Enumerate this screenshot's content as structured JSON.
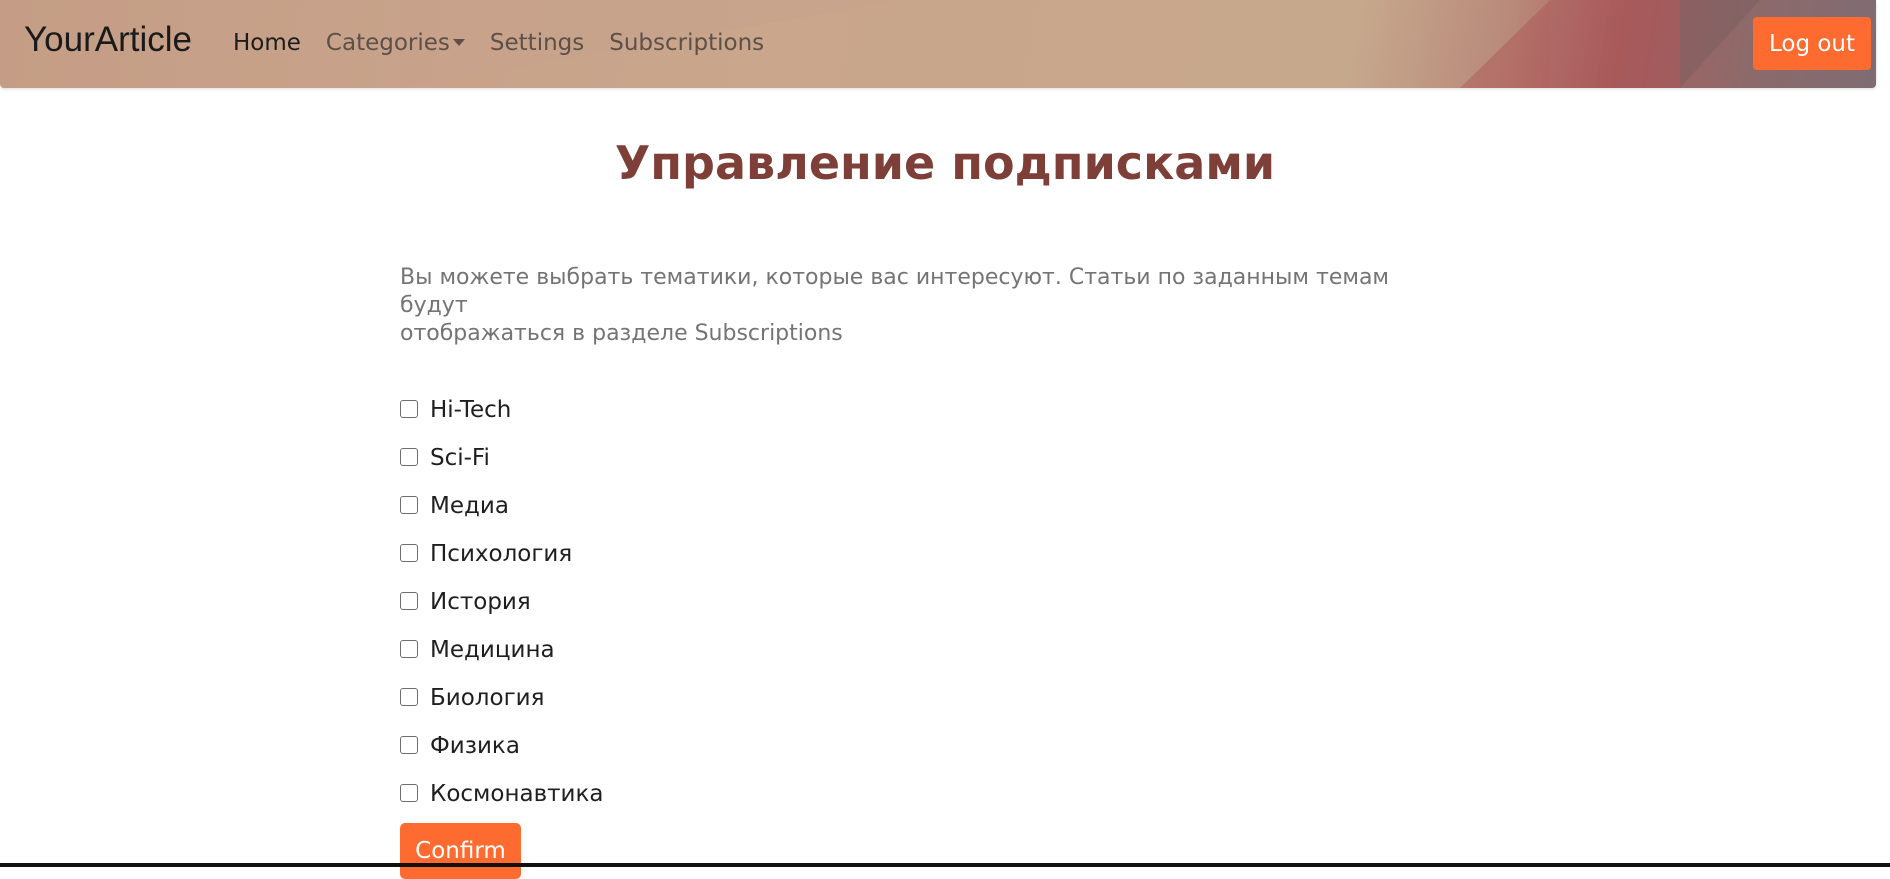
{
  "navbar": {
    "brand": "YourArticle",
    "links": [
      {
        "label": "Home"
      },
      {
        "label": "Categories"
      },
      {
        "label": "Settings"
      },
      {
        "label": "Subscriptions"
      }
    ],
    "logout_label": "Log out"
  },
  "main": {
    "title": "Управление подписками",
    "description_line1": "Вы можете выбрать тематики, которые вас интересуют. Статьи по заданным темам будут",
    "description_line2": "отображаться в разделе Subscriptions",
    "topics": [
      {
        "label": "Hi-Tech",
        "checked": false
      },
      {
        "label": "Sci-Fi",
        "checked": false
      },
      {
        "label": "Медиа",
        "checked": false
      },
      {
        "label": "Психология",
        "checked": false
      },
      {
        "label": "История",
        "checked": false
      },
      {
        "label": "Медицина",
        "checked": false
      },
      {
        "label": "Биология",
        "checked": false
      },
      {
        "label": "Физика",
        "checked": false
      },
      {
        "label": "Космонавтика",
        "checked": false
      }
    ],
    "confirm_label": "Confirm"
  },
  "colors": {
    "accent": "#fd6b31",
    "title": "#7d3f38",
    "description": "#747474"
  }
}
